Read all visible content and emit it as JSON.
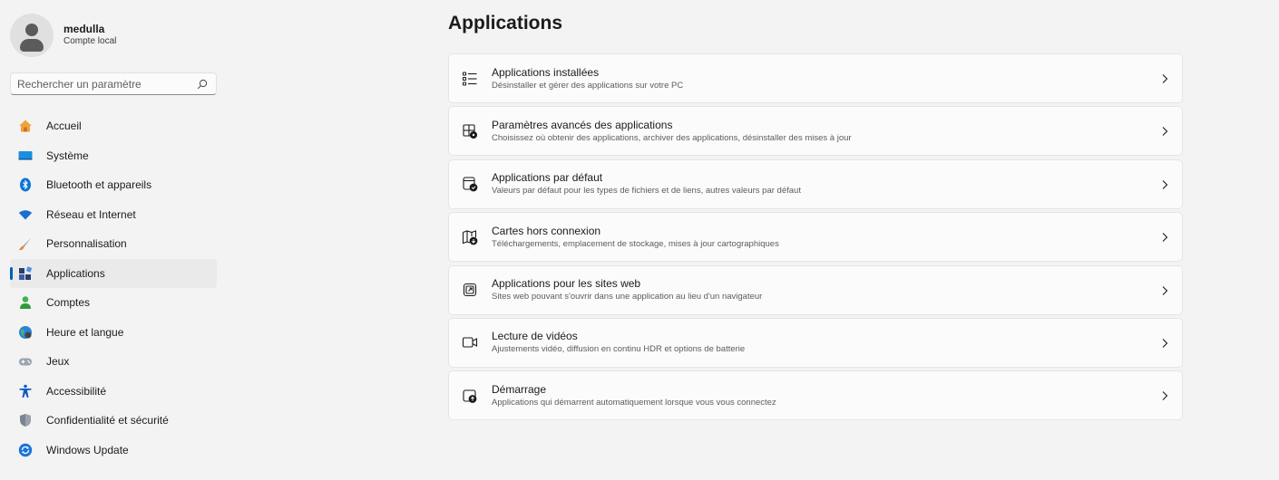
{
  "profile": {
    "name": "medulla",
    "subtitle": "Compte local"
  },
  "search": {
    "placeholder": "Rechercher un paramètre"
  },
  "nav": {
    "items": [
      {
        "label": "Accueil",
        "icon": "home-icon"
      },
      {
        "label": "Système",
        "icon": "system-icon"
      },
      {
        "label": "Bluetooth et appareils",
        "icon": "bluetooth-icon"
      },
      {
        "label": "Réseau et Internet",
        "icon": "network-icon"
      },
      {
        "label": "Personnalisation",
        "icon": "brush-icon"
      },
      {
        "label": "Applications",
        "icon": "apps-icon",
        "active": true
      },
      {
        "label": "Comptes",
        "icon": "accounts-icon"
      },
      {
        "label": "Heure et langue",
        "icon": "time-language-icon"
      },
      {
        "label": "Jeux",
        "icon": "gamepad-icon"
      },
      {
        "label": "Accessibilité",
        "icon": "accessibility-icon"
      },
      {
        "label": "Confidentialité et sécurité",
        "icon": "shield-icon"
      },
      {
        "label": "Windows Update",
        "icon": "windows-update-icon"
      }
    ]
  },
  "main": {
    "title": "Applications",
    "cards": [
      {
        "title": "Applications installées",
        "subtitle": "Désinstaller et gérer des applications sur votre PC",
        "icon": "installed-apps-icon"
      },
      {
        "title": "Paramètres avancés des applications",
        "subtitle": "Choisissez où obtenir des applications, archiver des applications, désinstaller des mises à jour",
        "icon": "advanced-app-settings-icon"
      },
      {
        "title": "Applications par défaut",
        "subtitle": "Valeurs par défaut pour les types de fichiers et de liens, autres valeurs par défaut",
        "icon": "default-apps-icon"
      },
      {
        "title": "Cartes hors connexion",
        "subtitle": "Téléchargements, emplacement de stockage, mises à jour cartographiques",
        "icon": "offline-maps-icon"
      },
      {
        "title": "Applications pour les sites web",
        "subtitle": "Sites web pouvant s'ouvrir dans une application au lieu d'un navigateur",
        "icon": "apps-for-websites-icon"
      },
      {
        "title": "Lecture de vidéos",
        "subtitle": "Ajustements vidéo, diffusion en continu HDR et options de batterie",
        "icon": "video-playback-icon"
      },
      {
        "title": "Démarrage",
        "subtitle": "Applications qui démarrent automatiquement lorsque vous vous connectez",
        "icon": "startup-icon"
      }
    ]
  },
  "colors": {
    "accent": "#005fb8",
    "background": "#f3f3f3",
    "card": "#fbfbfb"
  }
}
